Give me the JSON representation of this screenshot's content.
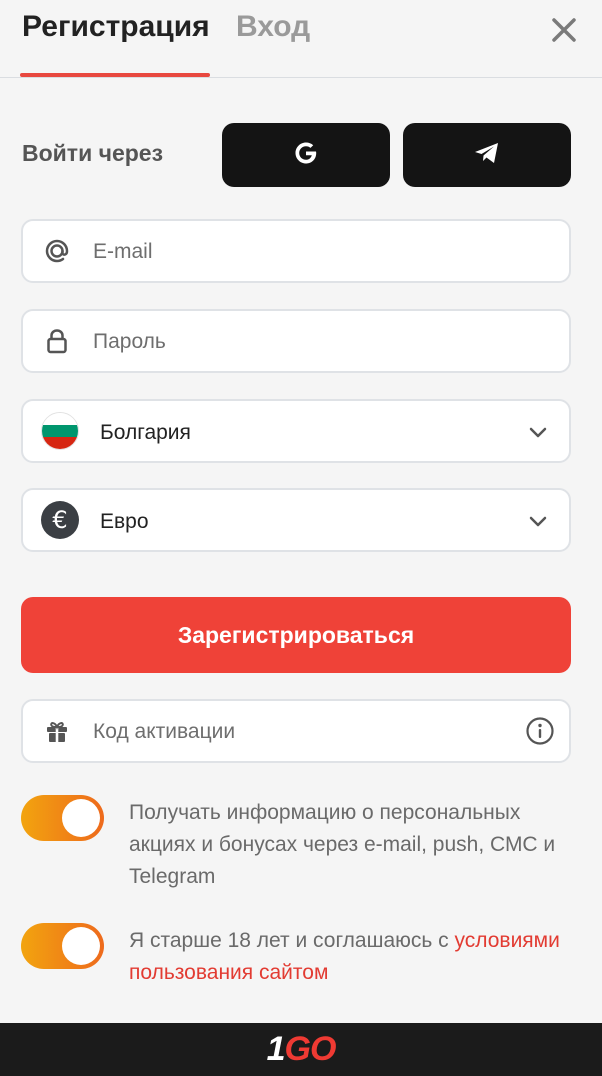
{
  "tabs": {
    "register": "Регистрация",
    "login": "Вход"
  },
  "social": {
    "label": "Войти через",
    "google_icon": "google-icon",
    "telegram_icon": "telegram-icon"
  },
  "fields": {
    "email": {
      "placeholder": "E-mail",
      "icon": "at-icon"
    },
    "password": {
      "placeholder": "Пароль",
      "icon": "lock-icon"
    },
    "country": {
      "value": "Болгария",
      "icon": "bulgaria-flag-icon"
    },
    "currency": {
      "value": "Евро",
      "symbol": "€",
      "icon": "euro-icon"
    },
    "promo": {
      "placeholder": "Код активации",
      "icon": "gift-icon"
    }
  },
  "submit_label": "Зарегистрироваться",
  "toggles": {
    "marketing": {
      "label": "Получать информацию о персональных акциях и бонусах через e-mail, push, СМС и Telegram",
      "on": true
    },
    "age": {
      "label_prefix": "Я старше 18 лет и соглашаюсь с ",
      "link": "условиями пользования сайтом",
      "on": true
    }
  },
  "footer": {
    "logo_1": "1",
    "logo_go": "GO"
  },
  "colors": {
    "accent": "#ef4238",
    "toggle_from": "#f2a40f",
    "toggle_to": "#ee6a1c",
    "dark": "#141414"
  }
}
